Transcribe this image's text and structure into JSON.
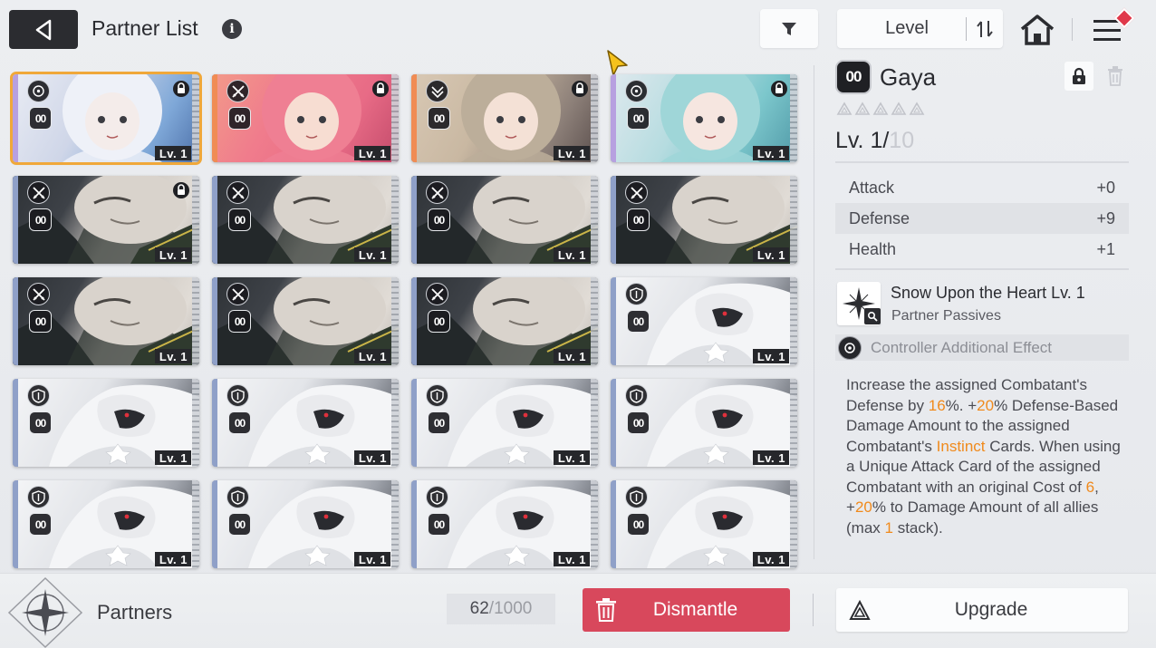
{
  "header": {
    "title": "Partner List",
    "info_icon": "info-icon",
    "back_icon": "back-arrow-icon",
    "filter_icon": "filter-icon",
    "sort_label": "Level",
    "sort_toggle_icon": "sort-order-icon",
    "home_icon": "home-icon",
    "menu_icon": "menu-icon"
  },
  "cards": [
    {
      "art": "white-hair-girl",
      "class": "target",
      "locked": true,
      "copies": "00",
      "level": "Lv. 1",
      "selected": true
    },
    {
      "art": "pink-hair-girl",
      "class": "swords",
      "locked": true,
      "copies": "00",
      "level": "Lv. 1",
      "selected": false
    },
    {
      "art": "brown-hair-girl",
      "class": "chevron",
      "locked": true,
      "copies": "00",
      "level": "Lv. 1",
      "selected": false
    },
    {
      "art": "teal-hair-girl",
      "class": "target",
      "locked": true,
      "copies": "00",
      "level": "Lv. 1",
      "selected": false
    },
    {
      "art": "bald-warrior",
      "class": "swords",
      "locked": true,
      "copies": "00",
      "level": "Lv. 1",
      "selected": false
    },
    {
      "art": "bald-warrior",
      "class": "swords",
      "locked": false,
      "copies": "00",
      "level": "Lv. 1",
      "selected": false
    },
    {
      "art": "bald-warrior",
      "class": "swords",
      "locked": false,
      "copies": "00",
      "level": "Lv. 1",
      "selected": false
    },
    {
      "art": "bald-warrior",
      "class": "swords",
      "locked": false,
      "copies": "00",
      "level": "Lv. 1",
      "selected": false
    },
    {
      "art": "bald-warrior",
      "class": "swords",
      "locked": false,
      "copies": "00",
      "level": "Lv. 1",
      "selected": false
    },
    {
      "art": "bald-warrior",
      "class": "swords",
      "locked": false,
      "copies": "00",
      "level": "Lv. 1",
      "selected": false
    },
    {
      "art": "bald-warrior",
      "class": "swords",
      "locked": false,
      "copies": "00",
      "level": "Lv. 1",
      "selected": false
    },
    {
      "art": "white-wolf-masked",
      "class": "shield",
      "locked": false,
      "copies": "00",
      "level": "Lv. 1",
      "selected": false
    },
    {
      "art": "white-wolf-masked",
      "class": "shield",
      "locked": false,
      "copies": "00",
      "level": "Lv. 1",
      "selected": false
    },
    {
      "art": "white-wolf-masked",
      "class": "shield",
      "locked": false,
      "copies": "00",
      "level": "Lv. 1",
      "selected": false
    },
    {
      "art": "white-wolf-masked",
      "class": "shield",
      "locked": false,
      "copies": "00",
      "level": "Lv. 1",
      "selected": false
    },
    {
      "art": "white-wolf-masked",
      "class": "shield",
      "locked": false,
      "copies": "00",
      "level": "Lv. 1",
      "selected": false
    },
    {
      "art": "white-wolf-masked",
      "class": "shield",
      "locked": false,
      "copies": "00",
      "level": "Lv. 1",
      "selected": false
    },
    {
      "art": "white-wolf-masked",
      "class": "shield",
      "locked": false,
      "copies": "00",
      "level": "Lv. 1",
      "selected": false
    },
    {
      "art": "white-wolf-masked",
      "class": "shield",
      "locked": false,
      "copies": "00",
      "level": "Lv. 1",
      "selected": false
    },
    {
      "art": "white-wolf-masked",
      "class": "shield",
      "locked": false,
      "copies": "00",
      "level": "Lv. 1",
      "selected": false
    }
  ],
  "detail": {
    "copies": "00",
    "name": "Gaya",
    "stars": 5,
    "level_prefix": "Lv. 1/",
    "level_max": "10",
    "stats": [
      {
        "label": "Attack",
        "value": "+0"
      },
      {
        "label": "Defense",
        "value": "+9"
      },
      {
        "label": "Health",
        "value": "+1"
      }
    ],
    "passive_name": "Snow Upon the Heart Lv. 1",
    "passive_type": "Partner Passives",
    "controller_label": "Controller Additional Effect",
    "description": [
      {
        "t": "Increase the assigned Combatant's Defense by ",
        "hl": false
      },
      {
        "t": "16",
        "hl": true
      },
      {
        "t": "%. +",
        "hl": false
      },
      {
        "t": "20",
        "hl": true
      },
      {
        "t": "% Defense-Based Damage Amount to the assigned Combatant's ",
        "hl": false
      },
      {
        "t": "Instinct",
        "hl": true
      },
      {
        "t": " Cards. When using a Unique Attack Card of the assigned Combatant with an original Cost of ",
        "hl": false
      },
      {
        "t": "6",
        "hl": true
      },
      {
        "t": ", +",
        "hl": false
      },
      {
        "t": "20",
        "hl": true
      },
      {
        "t": "% to Damage Amount of all allies (max ",
        "hl": false
      },
      {
        "t": "1",
        "hl": true
      },
      {
        "t": " stack).",
        "hl": false
      }
    ],
    "highlight_color": "#f08a1c"
  },
  "footer": {
    "section_label": "Partners",
    "count_current": "62",
    "count_sep": " / ",
    "count_max": "1000",
    "dismantle_label": "Dismantle",
    "upgrade_label": "Upgrade"
  },
  "colors": {
    "accent_selected": "#f0a83a",
    "dismantle": "#d8485c",
    "menu_badge": "#e0384a"
  }
}
